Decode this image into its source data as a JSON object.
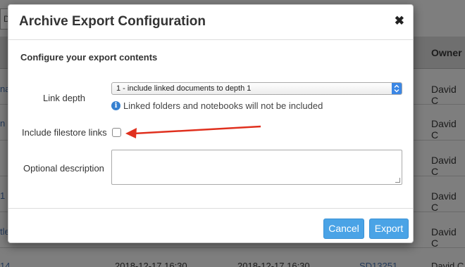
{
  "background": {
    "topbar_fragment": "D",
    "owner_header": "Owner",
    "owner_cells": [
      "David C",
      "David C",
      "David C",
      "David C",
      "David C",
      "David C"
    ],
    "left_fragments": [
      "na",
      "n",
      "",
      "1",
      "tle",
      "",
      "14"
    ],
    "bottom_row": {
      "date1": "2018-12-17 16:30",
      "date2": "2018-12-17 16:30",
      "id": "SD13251",
      "owner": "David C"
    }
  },
  "modal": {
    "title": "Archive Export Configuration",
    "close_symbol": "✖",
    "section_heading": "Configure your export contents",
    "link_depth": {
      "label": "Link depth",
      "selected": "1 - include linked documents to depth 1",
      "arrow_symbol": "⇕"
    },
    "info": {
      "icon_glyph": "i",
      "text": "Linked folders and notebooks will not be included"
    },
    "filestore": {
      "label": "Include filestore links",
      "checked": false
    },
    "description": {
      "label": "Optional description",
      "value": ""
    },
    "buttons": {
      "cancel": "Cancel",
      "export": "Export"
    }
  },
  "colors": {
    "button_blue": "#4aa3e6",
    "annotation_arrow": "#e0301e",
    "info_blue": "#3580d0"
  }
}
